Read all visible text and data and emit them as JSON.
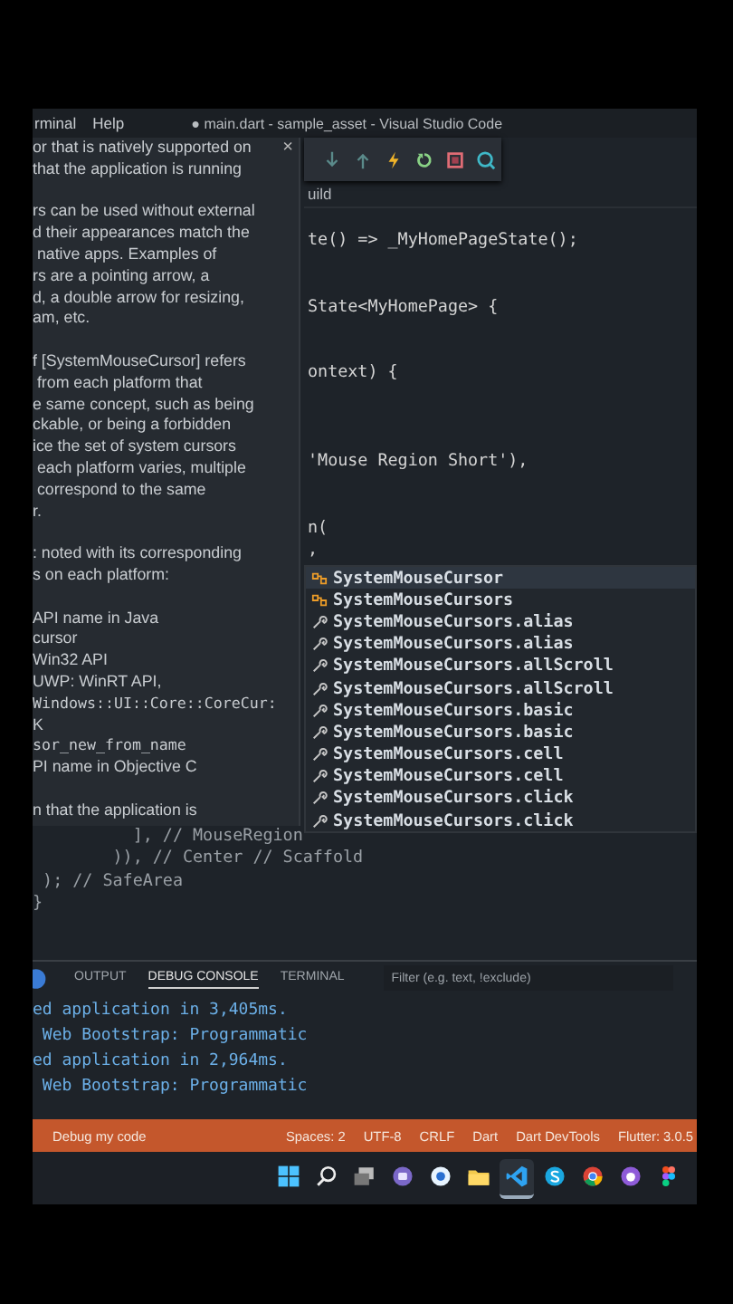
{
  "title_bar": {
    "menus": [
      "rminal",
      "Help"
    ],
    "title": "● main.dart - sample_asset - Visual Studio Code"
  },
  "breadcrumb": "uild",
  "editor": {
    "upper_lines": [
      "te() => _MyHomePageState();",
      "State<MyHomePage> {",
      "ontext) {",
      "'Mouse Region Short'),",
      "n(",
      ","
    ],
    "lower_lines": [
      "          ], // MouseRegion",
      "        )), // Center // Scaffold",
      " ); // SafeArea",
      "}"
    ]
  },
  "hover_doc": {
    "close": "×",
    "blocks": [
      {
        "kind": "paragraph",
        "lines": [
          "or that is natively supported on",
          "that the application is running"
        ]
      },
      {
        "kind": "paragraph",
        "lines": [
          "rs can be used without external",
          "d their appearances match the",
          " native apps. Examples of",
          "rs are a pointing arrow, a",
          "d, a double arrow for resizing,",
          "am, etc."
        ]
      },
      {
        "kind": "paragraph",
        "lines": [
          "f [SystemMouseCursor] refers",
          " from each platform that",
          "e same concept, such as being",
          "ckable, or being a forbidden",
          "ice the set of system cursors",
          " each platform varies, multiple",
          " correspond to the same",
          "r."
        ]
      },
      {
        "kind": "paragraph",
        "lines": [
          ": noted with its corresponding",
          "s on each platform:"
        ]
      },
      {
        "kind": "list",
        "items": [
          {
            "kind": "text",
            "text": "API name in Java"
          },
          {
            "kind": "text",
            "text": "cursor"
          },
          {
            "kind": "text",
            "text": "Win32 API"
          },
          {
            "kind": "text",
            "text": "UWP: WinRT API,"
          },
          {
            "kind": "code",
            "text": "Windows::UI::Core::CoreCur:"
          },
          {
            "kind": "text",
            "text": "K"
          },
          {
            "kind": "code",
            "text": "sor_new_from_name"
          },
          {
            "kind": "text",
            "text": "PI name in Objective C"
          }
        ]
      },
      {
        "kind": "paragraph",
        "lines": [
          "n that the application is"
        ]
      }
    ]
  },
  "suggestions": [
    {
      "kind": "class",
      "label": "SystemMouseCursor",
      "selected": true
    },
    {
      "kind": "class",
      "label": "SystemMouseCursors",
      "selected": false
    },
    {
      "kind": "property",
      "label": "SystemMouseCursors.alias",
      "selected": false
    },
    {
      "kind": "property",
      "label": "SystemMouseCursors.alias",
      "selected": false
    },
    {
      "kind": "property",
      "label": "SystemMouseCursors.allScroll",
      "selected": false
    },
    {
      "kind": "property",
      "label": "SystemMouseCursors.allScroll",
      "selected": false
    },
    {
      "kind": "property",
      "label": "SystemMouseCursors.basic",
      "selected": false
    },
    {
      "kind": "property",
      "label": "SystemMouseCursors.basic",
      "selected": false
    },
    {
      "kind": "property",
      "label": "SystemMouseCursors.cell",
      "selected": false
    },
    {
      "kind": "property",
      "label": "SystemMouseCursors.cell",
      "selected": false
    },
    {
      "kind": "property",
      "label": "SystemMouseCursors.click",
      "selected": false
    },
    {
      "kind": "property",
      "label": "SystemMouseCursors.click",
      "selected": false
    }
  ],
  "panel": {
    "tabs": [
      {
        "label": "OUTPUT",
        "selected": false
      },
      {
        "label": "DEBUG CONSOLE",
        "selected": true
      },
      {
        "label": "TERMINAL",
        "selected": false
      }
    ],
    "filter": {
      "placeholder": "Filter (e.g. text, !exclude)"
    },
    "console_lines": [
      "ed application in 3,405ms.",
      " Web Bootstrap: Programmatic",
      "ed application in 2,964ms.",
      " Web Bootstrap: Programmatic"
    ]
  },
  "status_bar": {
    "left": "Debug my code",
    "right": [
      "Spaces: 2",
      "UTF-8",
      "CRLF",
      "Dart",
      "Dart DevTools",
      "Flutter: 3.0.5"
    ]
  },
  "taskbar": {
    "apps": [
      {
        "kind": "start",
        "active": false
      },
      {
        "kind": "search",
        "active": false
      },
      {
        "kind": "taskview",
        "active": false
      },
      {
        "kind": "chat",
        "active": false
      },
      {
        "kind": "circle",
        "active": false
      },
      {
        "kind": "folder",
        "active": false
      },
      {
        "kind": "vscode",
        "active": true
      },
      {
        "kind": "skype",
        "active": false
      },
      {
        "kind": "chrome",
        "active": false
      },
      {
        "kind": "github",
        "active": false
      },
      {
        "kind": "figma",
        "active": false
      }
    ]
  }
}
